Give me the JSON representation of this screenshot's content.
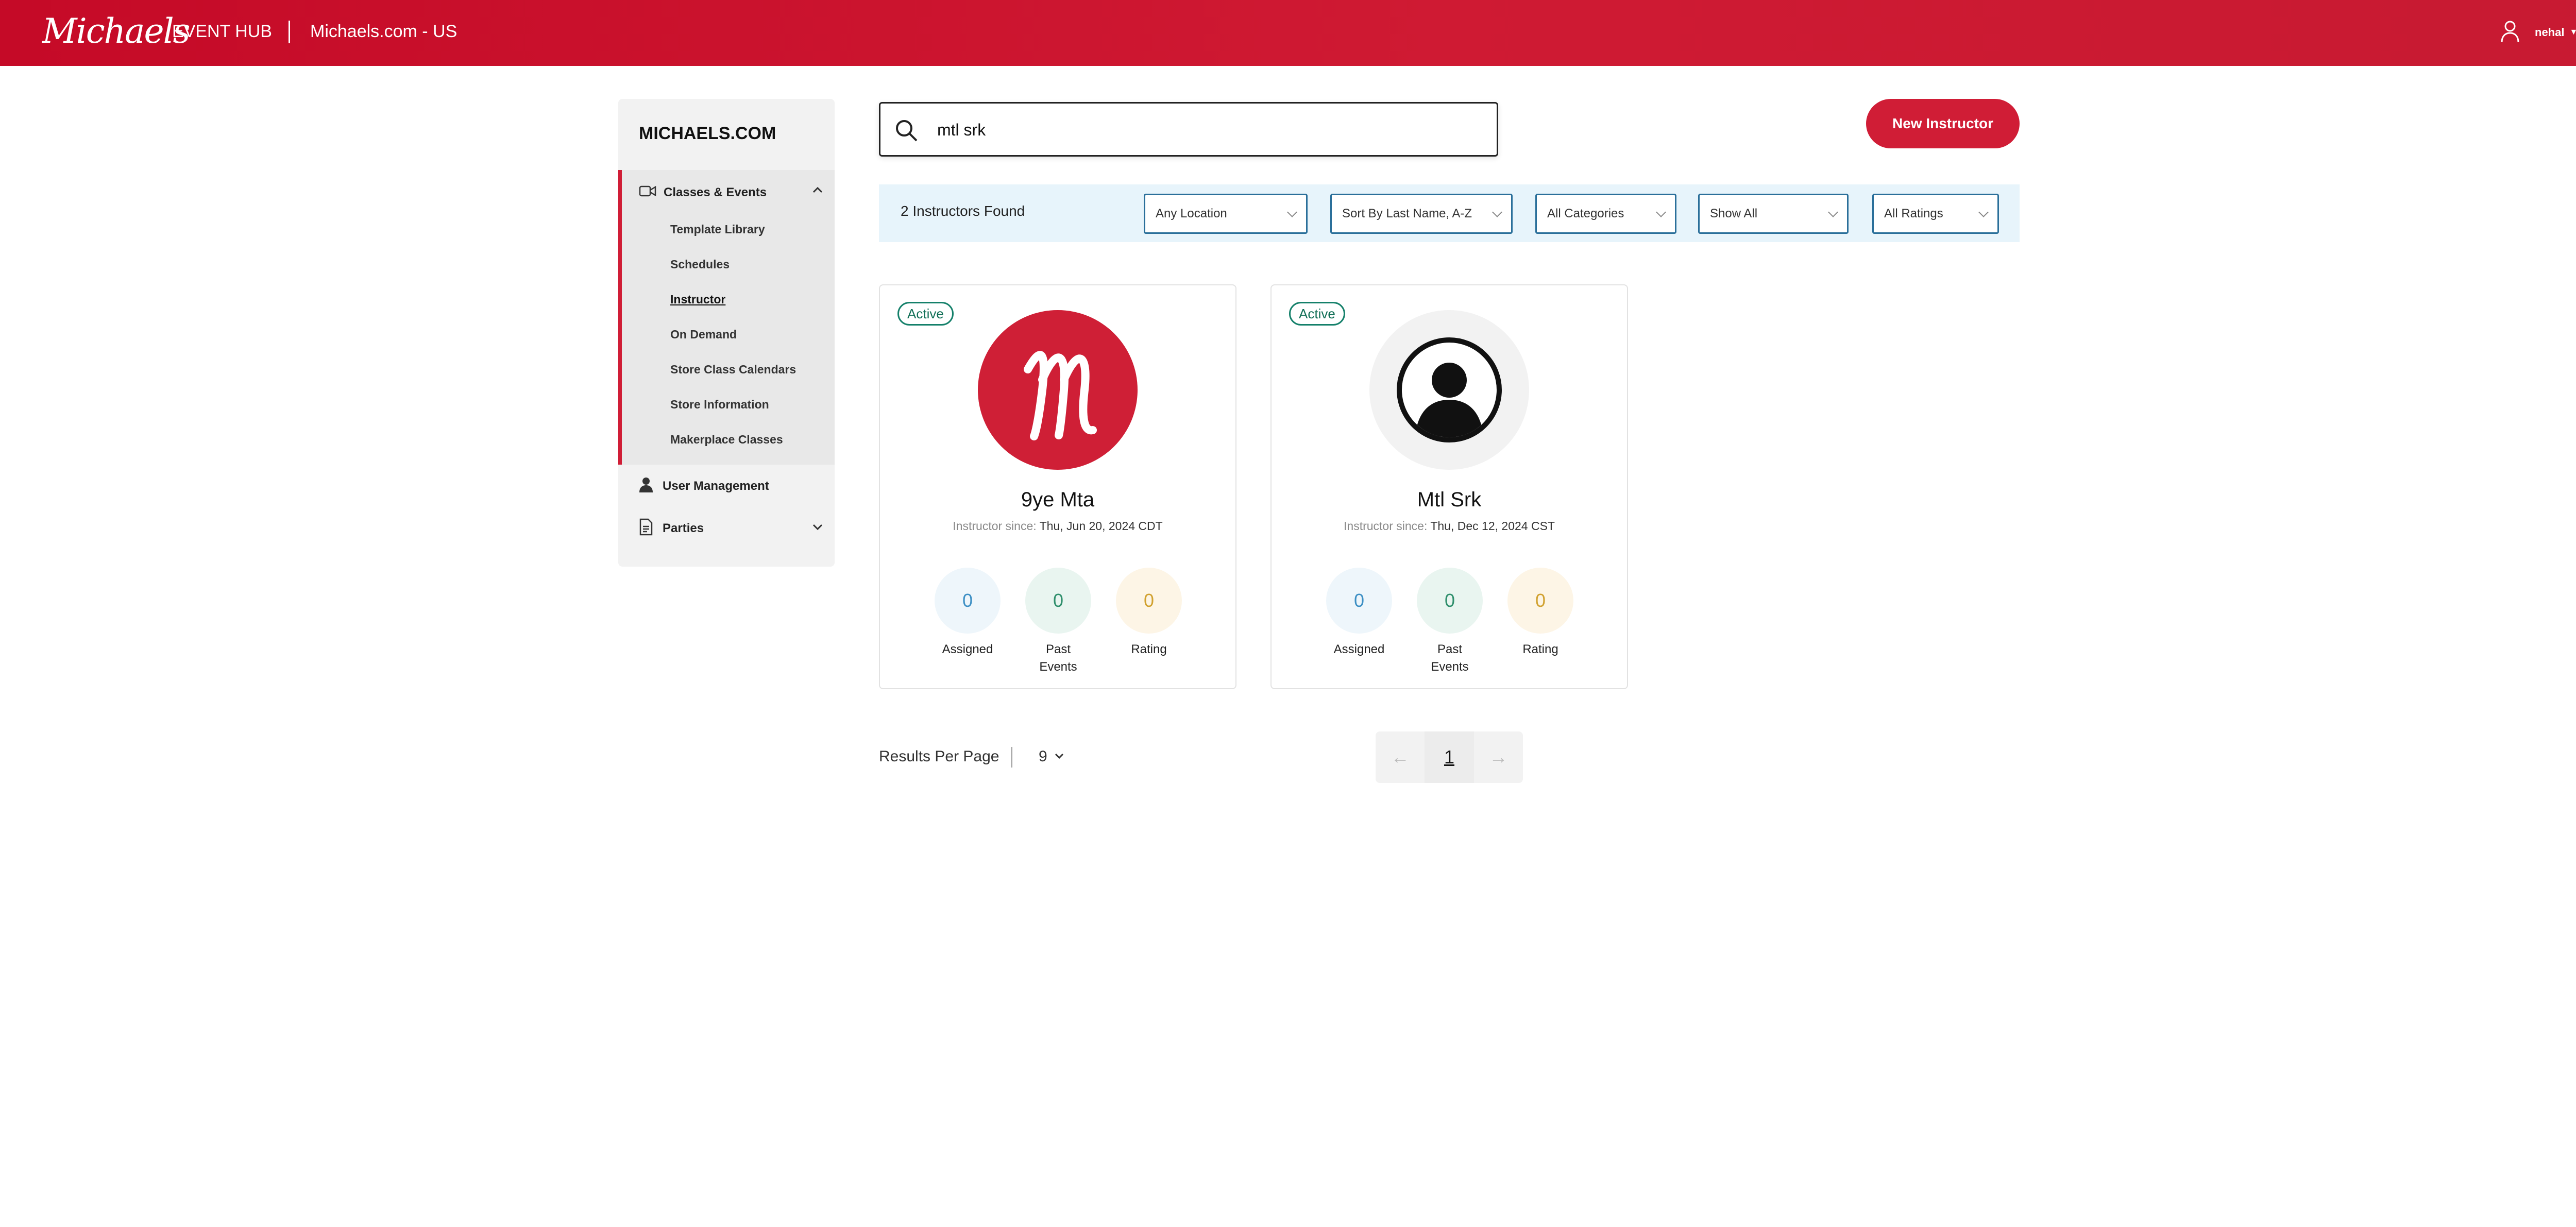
{
  "header": {
    "brand": "Michaels",
    "hub_title": "EVENT HUB",
    "site_title": "Michaels.com - US",
    "user_name": "nehal"
  },
  "sidebar": {
    "title": "MICHAELS.COM",
    "group": {
      "label": "Classes & Events",
      "items": [
        {
          "label": "Template Library"
        },
        {
          "label": "Schedules"
        },
        {
          "label": "Instructor"
        },
        {
          "label": "On Demand"
        },
        {
          "label": "Store Class Calendars"
        },
        {
          "label": "Store Information"
        },
        {
          "label": "Makerplace Classes"
        }
      ]
    },
    "user_management": "User Management",
    "parties": "Parties"
  },
  "search": {
    "value": "mtl srk"
  },
  "new_button": "New Instructor",
  "filters": {
    "found": "2 Instructors Found",
    "location": "Any Location",
    "sort": "Sort By Last Name, A-Z",
    "categories": "All Categories",
    "show": "Show All",
    "ratings": "All Ratings"
  },
  "cards": [
    {
      "status": "Active",
      "name": "9ye Mta",
      "since_label": "Instructor since:",
      "since_date": "Thu, Jun 20, 2024 CDT",
      "assigned": "0",
      "assigned_label": "Assigned",
      "past_events": "0",
      "past_events_label": "Past Events",
      "rating": "0",
      "rating_label": "Rating"
    },
    {
      "status": "Active",
      "name": "Mtl Srk",
      "since_label": "Instructor since:",
      "since_date": "Thu, Dec 12, 2024 CST",
      "assigned": "0",
      "assigned_label": "Assigned",
      "past_events": "0",
      "past_events_label": "Past Events",
      "rating": "0",
      "rating_label": "Rating"
    }
  ],
  "pagination": {
    "results_per_page_label": "Results Per Page",
    "results_per_page": "9",
    "prev": "←",
    "current_page": "1",
    "next": "→"
  },
  "colors": {
    "brand_red": "#d01d36",
    "filter_bg": "#e7f4fb",
    "active_green": "#14806a"
  }
}
